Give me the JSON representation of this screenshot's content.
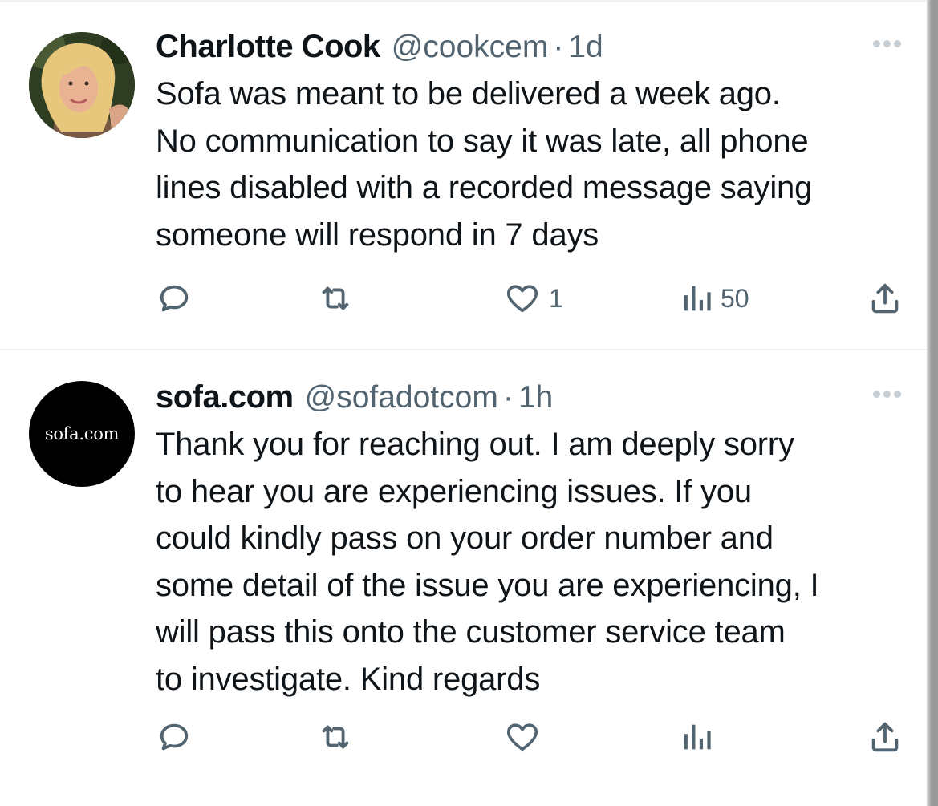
{
  "tweets": [
    {
      "name": "Charlotte Cook",
      "handle": "@cookcem",
      "separator": "·",
      "time": "1d",
      "lines": [
        "Sofa was meant to be delivered a week ago.",
        "No communication to say it was late, all phone",
        "lines disabled with a recorded message saying",
        "someone will respond in 7 days"
      ],
      "likes": "1",
      "views": "50",
      "avatar_icon": "person-photo-avatar"
    },
    {
      "name": "sofa.com",
      "handle": "@sofadotcom",
      "separator": "·",
      "time": "1h",
      "avatar_text": "sofa.com",
      "lines": [
        "Thank you for reaching out. I am deeply sorry",
        "to hear you are experiencing issues. If you",
        "could kindly pass on your order number and",
        "some detail of the issue you are experiencing, I",
        "will pass this onto the customer service team",
        "to investigate. Kind regards"
      ],
      "likes": "",
      "views": ""
    }
  ],
  "colors": {
    "text": "#0f1419",
    "secondary": "#536471",
    "divider": "#eff3f4",
    "more_dots": "#c7cfd5"
  }
}
